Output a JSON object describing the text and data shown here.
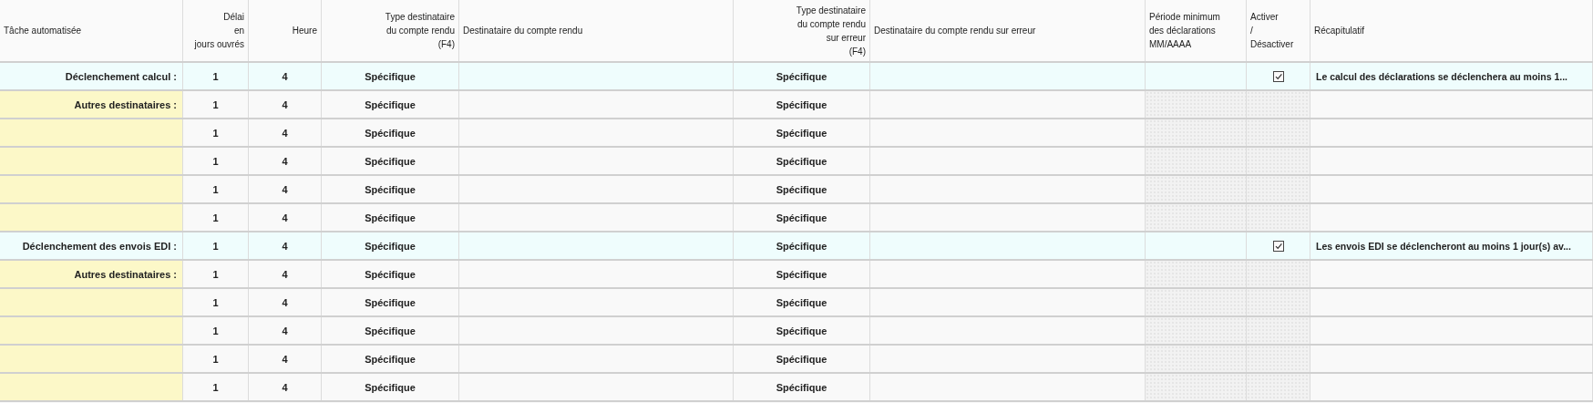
{
  "table": {
    "columns": [
      "Tâche automatisée",
      "Délai\nen\njours ouvrés",
      "Heure",
      "Type destinataire\ndu compte rendu\n(F4)",
      "Destinataire du compte rendu",
      "Type destinataire\ndu compte rendu\nsur erreur\n(F4)",
      "Destinataire du compte rendu sur erreur",
      "Période minimum\ndes déclarations\nMM/AAAA",
      "Activer\n/\nDésactiver",
      "Récapitulatif"
    ],
    "rows": [
      {
        "kind": "trigger",
        "label": "Déclenchement calcul :",
        "delay": "1",
        "hour": "4",
        "type": "Spécifique",
        "type_error": "Spécifique",
        "active": true,
        "summary": "Le calcul des déclarations se déclenchera au moins 1..."
      },
      {
        "kind": "recipient",
        "label": "Autres destinataires :",
        "delay": "1",
        "hour": "4",
        "type": "Spécifique",
        "type_error": "Spécifique"
      },
      {
        "kind": "recipient",
        "delay": "1",
        "hour": "4",
        "type": "Spécifique",
        "type_error": "Spécifique"
      },
      {
        "kind": "recipient",
        "delay": "1",
        "hour": "4",
        "type": "Spécifique",
        "type_error": "Spécifique"
      },
      {
        "kind": "recipient",
        "delay": "1",
        "hour": "4",
        "type": "Spécifique",
        "type_error": "Spécifique"
      },
      {
        "kind": "recipient",
        "delay": "1",
        "hour": "4",
        "type": "Spécifique",
        "type_error": "Spécifique"
      },
      {
        "kind": "trigger",
        "label": "Déclenchement des envois EDI :",
        "delay": "1",
        "hour": "4",
        "type": "Spécifique",
        "type_error": "Spécifique",
        "active": true,
        "summary": "Les envois EDI se déclencheront au moins 1 jour(s) av..."
      },
      {
        "kind": "recipient",
        "label": "Autres destinataires :",
        "delay": "1",
        "hour": "4",
        "type": "Spécifique",
        "type_error": "Spécifique"
      },
      {
        "kind": "recipient",
        "delay": "1",
        "hour": "4",
        "type": "Spécifique",
        "type_error": "Spécifique"
      },
      {
        "kind": "recipient",
        "delay": "1",
        "hour": "4",
        "type": "Spécifique",
        "type_error": "Spécifique"
      },
      {
        "kind": "recipient",
        "delay": "1",
        "hour": "4",
        "type": "Spécifique",
        "type_error": "Spécifique"
      },
      {
        "kind": "recipient",
        "delay": "1",
        "hour": "4",
        "type": "Spécifique",
        "type_error": "Spécifique"
      }
    ]
  }
}
